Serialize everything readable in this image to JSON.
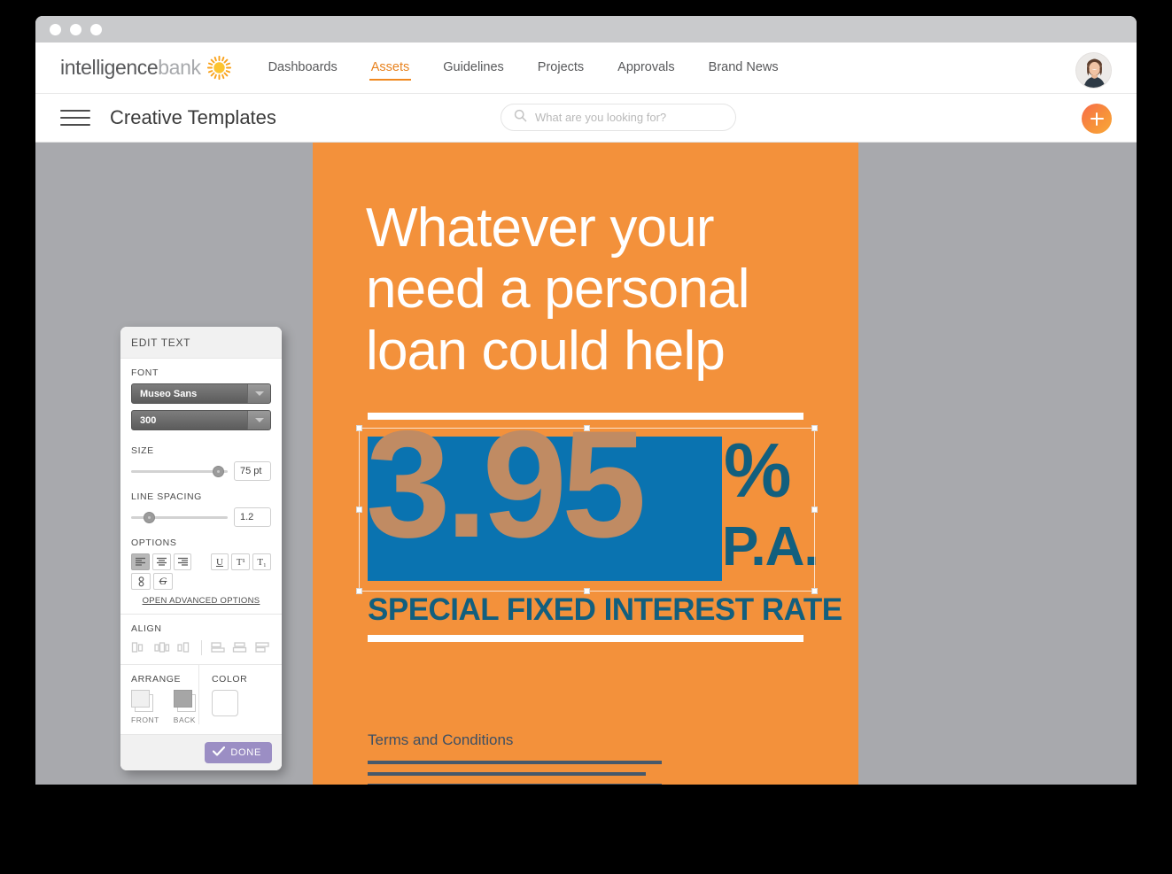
{
  "window": {
    "titlebar_dots": [
      "dot-1",
      "dot-2",
      "dot-3"
    ]
  },
  "topnav": {
    "logo_part1": "intelligence",
    "logo_part2": "bank",
    "logo_icon": "sun-icon",
    "links": [
      {
        "label": "Dashboards",
        "active": false
      },
      {
        "label": "Assets",
        "active": true
      },
      {
        "label": "Guidelines",
        "active": false
      },
      {
        "label": "Projects",
        "active": false
      },
      {
        "label": "Approvals",
        "active": false
      },
      {
        "label": "Brand News",
        "active": false
      }
    ],
    "avatar_icon": "user-avatar"
  },
  "subbar": {
    "menu_icon": "hamburger-menu-icon",
    "page_title": "Creative Templates",
    "search_placeholder": "What are you looking for?",
    "search_value": "",
    "search_icon": "search-icon",
    "add_icon": "plus-icon"
  },
  "panel": {
    "title": "EDIT TEXT",
    "font": {
      "label": "FONT",
      "family_value": "Museo Sans",
      "weight_value": "300",
      "dropdown_icon": "chevron-down-icon"
    },
    "size": {
      "label": "SIZE",
      "value": "75 pt",
      "slider_percent": 88
    },
    "line_spacing": {
      "label": "LINE SPACING",
      "value": "1.2",
      "slider_percent": 17
    },
    "options": {
      "label": "OPTIONS",
      "buttons": [
        {
          "name": "align-left-icon",
          "active": true
        },
        {
          "name": "align-center-icon",
          "active": false
        },
        {
          "name": "align-right-icon",
          "active": false
        },
        {
          "name": "underline-icon",
          "active": false,
          "glyph": "U"
        },
        {
          "name": "superscript-icon",
          "active": false,
          "glyph": "T¹"
        },
        {
          "name": "subscript-icon",
          "active": false,
          "glyph": "T₁"
        },
        {
          "name": "link-icon",
          "active": false
        },
        {
          "name": "strikethrough-g-icon",
          "active": false,
          "glyph": "G"
        }
      ],
      "advanced_link": "OPEN ADVANCED OPTIONS"
    },
    "align": {
      "label": "ALIGN",
      "buttons": [
        "align-object-left-icon",
        "align-object-center-icon",
        "align-object-right-icon",
        "align-object-top-icon",
        "align-object-middle-icon",
        "align-object-bottom-icon"
      ]
    },
    "arrange": {
      "label": "ARRANGE",
      "front_label": "FRONT",
      "back_label": "BACK"
    },
    "color": {
      "label": "COLOR",
      "swatch_value": "#ffffff"
    },
    "done_label": "DONE",
    "done_icon": "check-icon"
  },
  "poster": {
    "headline": "Whatever your need a personal loan could help",
    "rate_number": "3.95",
    "percent_symbol": "%",
    "per_annum": "P.A.",
    "subtext": "SPECIAL FIXED INTEREST RATE",
    "terms_title": "Terms and Conditions"
  },
  "colors": {
    "poster_orange": "#f3913b",
    "canvas_gray": "#a8a9ad",
    "selection_blue": "#0a73b0",
    "rate_tan": "#c08b63",
    "deep_teal": "#125f7e",
    "accent_orange": "#f0881f",
    "done_purple": "#9b8ec4"
  }
}
